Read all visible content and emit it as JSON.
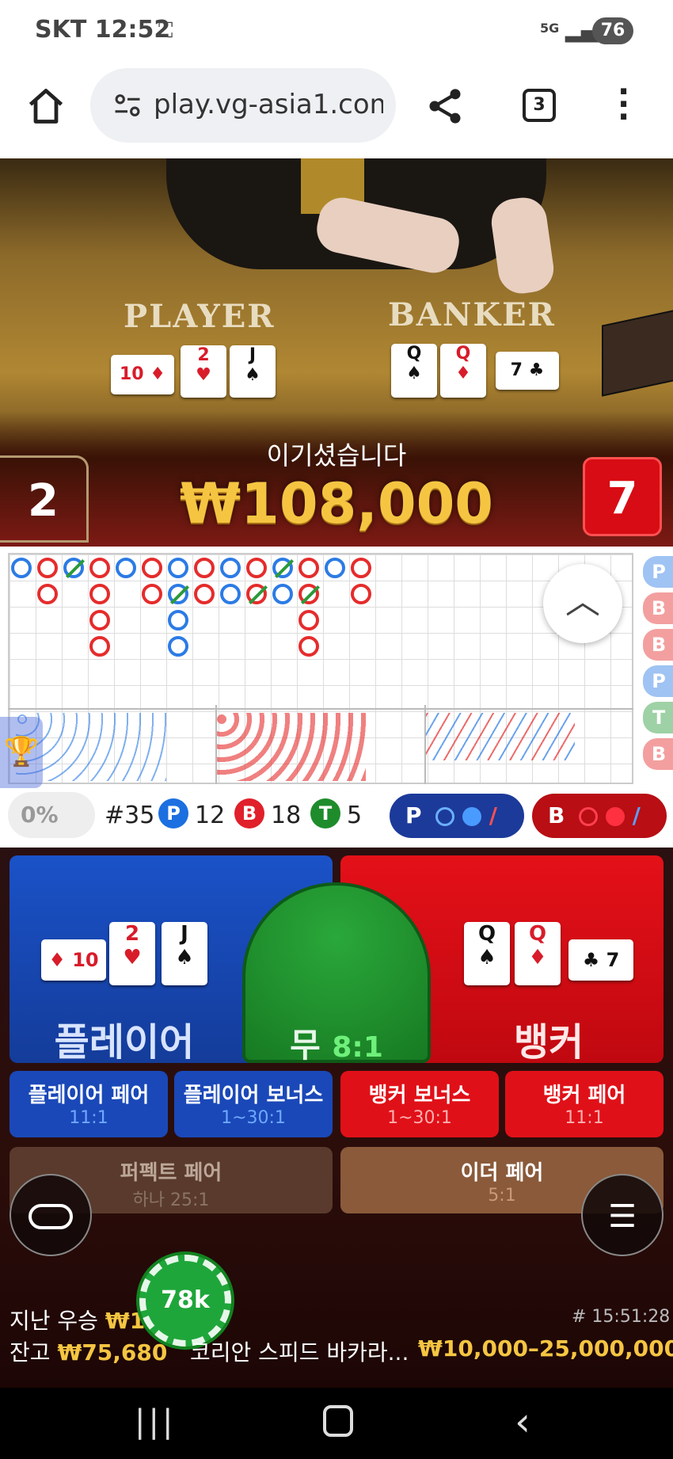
{
  "status_bar": {
    "carrier": "SKT",
    "time": "12:52",
    "network": "5G",
    "battery": "76"
  },
  "browser": {
    "url": "play.vg-asia1.com",
    "tab_count": "3"
  },
  "video": {
    "player_label": "PLAYER",
    "banker_label": "BANKER",
    "player_cards": [
      {
        "rank": "10",
        "suit": "♦",
        "color": "red"
      },
      {
        "rank": "2",
        "suit": "♥",
        "color": "red"
      },
      {
        "rank": "J",
        "suit": "♠",
        "color": "black"
      }
    ],
    "banker_cards": [
      {
        "rank": "Q",
        "suit": "♠",
        "color": "black"
      },
      {
        "rank": "Q",
        "suit": "♦",
        "color": "red"
      },
      {
        "rank": "7",
        "suit": "♣",
        "color": "black"
      }
    ],
    "win_message": "이기셨습니다",
    "win_amount": "₩108,000",
    "player_score": "2",
    "banker_score": "7"
  },
  "roadmap": {
    "side_labels": [
      "P",
      "B",
      "B",
      "P",
      "T",
      "B"
    ],
    "stats": {
      "percent": "0%",
      "round": "#35",
      "player_label": "P",
      "player_count": "12",
      "banker_label": "B",
      "banker_count": "18",
      "tie_label": "T",
      "tie_count": "5"
    },
    "predict_player": "P",
    "predict_banker": "B"
  },
  "betting": {
    "player": {
      "label": "플레이어",
      "cards": [
        {
          "rank": "10",
          "suit": "♦",
          "color": "red"
        },
        {
          "rank": "2",
          "suit": "♥",
          "color": "red"
        },
        {
          "rank": "J",
          "suit": "♠",
          "color": "black"
        }
      ]
    },
    "tie": {
      "label": "무",
      "odds": "8:1"
    },
    "banker": {
      "label": "뱅커",
      "cards": [
        {
          "rank": "Q",
          "suit": "♠",
          "color": "black"
        },
        {
          "rank": "Q",
          "suit": "♦",
          "color": "red"
        },
        {
          "rank": "7",
          "suit": "♣",
          "color": "black"
        }
      ]
    },
    "player_pair": {
      "label": "플레이어 페어",
      "odds": "11:1"
    },
    "player_bonus": {
      "label": "플레이어 보너스",
      "odds": "1~30:1"
    },
    "banker_bonus": {
      "label": "뱅커 보너스",
      "odds": "1~30:1"
    },
    "banker_pair": {
      "label": "뱅커 페어",
      "odds": "11:1"
    },
    "perfect_pair": {
      "label": "퍼펙트 페어",
      "odds": "하나 25:1"
    },
    "either_pair": {
      "label": "이더 페어",
      "odds": "5:1"
    },
    "chip_value": "78k",
    "last_win_label": "지난 우승",
    "last_win_value": "₩1",
    "timestamp": "# 15:51:28",
    "balance_label": "잔고",
    "balance_value": "₩75,680",
    "table_name": "코리안 스피드 바카라...",
    "bet_limits": "₩10,000–25,000,000"
  },
  "colors": {
    "player_blue": "#1c4bb8",
    "banker_red": "#d80c14",
    "tie_green": "#1f8c2c",
    "gold": "#f5c542"
  }
}
